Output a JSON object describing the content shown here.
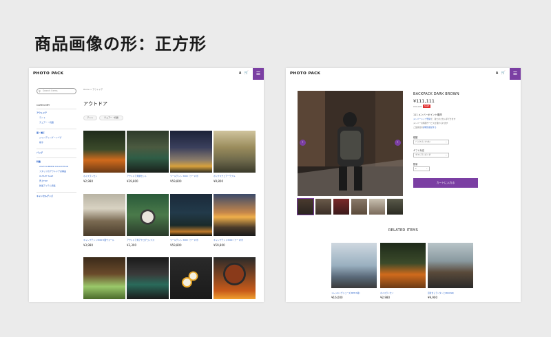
{
  "heading": "商品画像の形：正方形",
  "brand": "PHOTO PACK",
  "colors": {
    "accent": "#7b3fa3",
    "link": "#2962c9",
    "sale": "#e03131"
  },
  "icons": {
    "user": "user-icon",
    "cart": "cart-icon",
    "menu": "menu-icon",
    "search": "search-icon"
  },
  "list_page": {
    "search_placeholder": "Search items",
    "category_title": "CATEGORY",
    "categories": [
      {
        "label": "アウトドア",
        "level": "main"
      },
      {
        "label": "テント",
        "level": "sub"
      },
      {
        "label": "チェアー・机器",
        "level": "sub"
      },
      {
        "label": "服・帽子",
        "level": "main"
      },
      {
        "label": "ジャンディングーンバグ",
        "level": "sub"
      },
      {
        "label": "帽子",
        "level": "sub"
      },
      {
        "label": "バッグ",
        "level": "main"
      },
      {
        "label": "特集",
        "level": "main"
      },
      {
        "label": "2023 SUMMER COLLECTION",
        "level": "sub"
      },
      {
        "label": "スタッフのアウトドア必需品",
        "level": "sub"
      },
      {
        "label": "OUTLET SALE",
        "level": "sub"
      },
      {
        "label": "売上TOP",
        "level": "sub"
      },
      {
        "label": "新着アイテム特集",
        "level": "sub"
      },
      {
        "label": "キャンセルグッズ",
        "level": "main"
      }
    ],
    "breadcrumb": "Home  >  アウトドア",
    "title": "アウトドア",
    "chips": [
      "テント",
      "チェアー・机器"
    ],
    "products": [
      {
        "name": "ホイスランセン",
        "price": "¥2,980"
      },
      {
        "name": "アウトドア用鍋セット",
        "price": "¥29,800"
      },
      {
        "name": "ツールテント 3000（フード付）",
        "price": "¥59,800"
      },
      {
        "name": "ボックスウェアーテブル",
        "price": "¥9,800"
      },
      {
        "name": "キャンプテント3000 5面ウォール",
        "price": "¥3,980"
      },
      {
        "name": "アウトドア用アナログコンパス",
        "price": "¥3,300"
      },
      {
        "name": "ツールテント 3000（フード付）",
        "price": "¥59,800"
      },
      {
        "name": "キャンプテント3000（フード付）",
        "price": "¥59,800"
      },
      {
        "name": "",
        "price": ""
      },
      {
        "name": "",
        "price": ""
      },
      {
        "name": "",
        "price": ""
      },
      {
        "name": "",
        "price": ""
      }
    ]
  },
  "detail_page": {
    "title": "BACKPACK DARK BROWN",
    "price": "¥111,111",
    "sku": "¥99,999",
    "sale_badge": "SALE",
    "points": "111 メンバーポイント獲得",
    "note1_link": "メンバーシップ登録",
    "note1_rest": "で、新たのさを入手できます",
    "note2": "メンバーの特別サービスを受けられます",
    "note3_prefix": "ご注意点の",
    "note3_link": "詳細を確認する",
    "options": [
      {
        "label": "種類",
        "value": "バックパック(大)"
      },
      {
        "label": "ギフト対応",
        "value": "ギフトラッピング"
      },
      {
        "label": "数量",
        "value": "1"
      }
    ],
    "cart_label": "カートに入れる",
    "related_title": "RELATED ITEMS",
    "related": [
      {
        "name": "トレッキングシューズ(MEN'S用)",
        "price": "¥16,000"
      },
      {
        "name": "ホイスランセン",
        "price": "¥2,980"
      },
      {
        "name": "目覚ましランタンと(BROWN)",
        "price": "¥9,900"
      }
    ]
  }
}
